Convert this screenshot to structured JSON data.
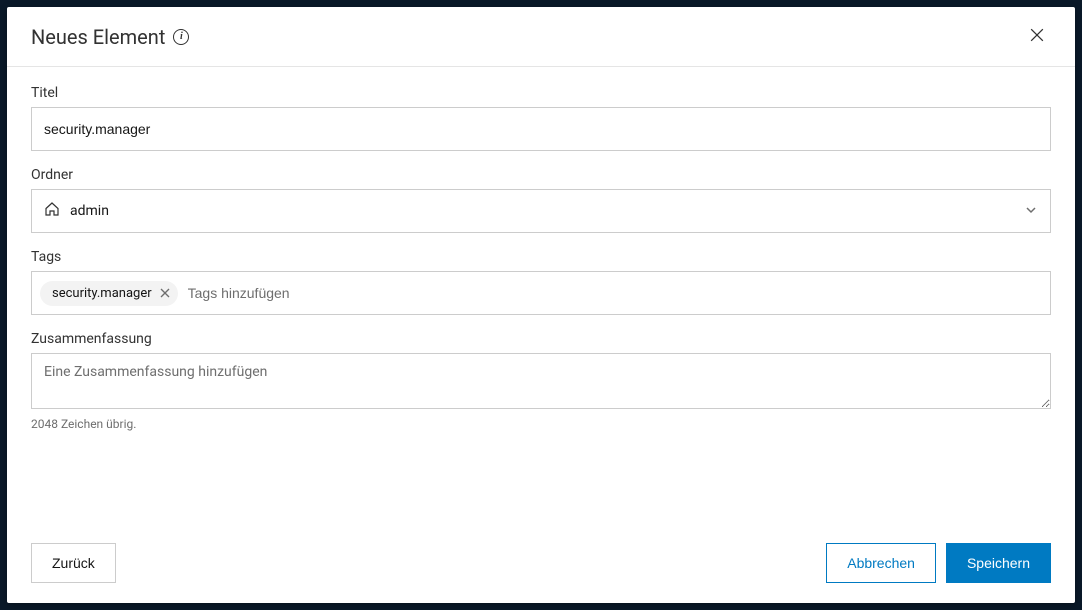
{
  "header": {
    "title": "Neues Element"
  },
  "form": {
    "title": {
      "label": "Titel",
      "value": "security.manager"
    },
    "folder": {
      "label": "Ordner",
      "value": "admin"
    },
    "tags": {
      "label": "Tags",
      "chips": [
        {
          "text": "security.manager"
        }
      ],
      "placeholder": "Tags hinzufügen"
    },
    "summary": {
      "label": "Zusammenfassung",
      "placeholder": "Eine Zusammenfassung hinzufügen",
      "counter": "2048 Zeichen übrig."
    }
  },
  "footer": {
    "back": "Zurück",
    "cancel": "Abbrechen",
    "save": "Speichern"
  }
}
